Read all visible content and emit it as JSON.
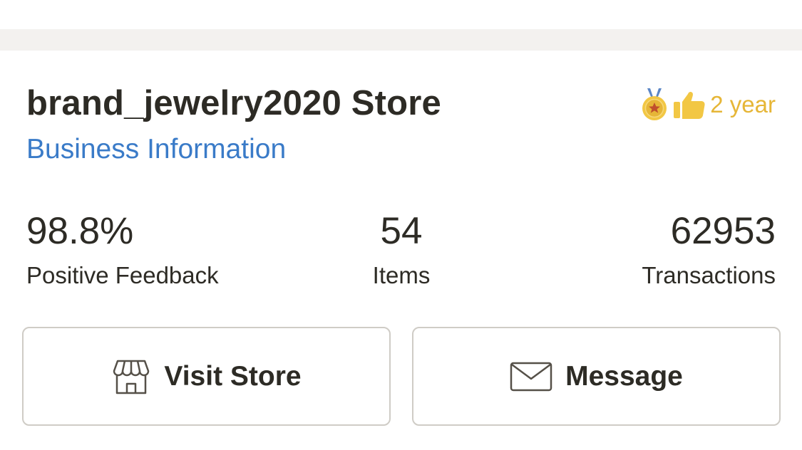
{
  "store": {
    "name": "brand_jewelry2020 Store",
    "business_link": "Business Information",
    "seller_years": "2 year",
    "badge_color": "#e6b637",
    "link_color": "#3a7bc8"
  },
  "stats": {
    "feedback": {
      "value": "98.8%",
      "label": "Positive Feedback"
    },
    "items": {
      "value": "54",
      "label": "Items"
    },
    "transactions": {
      "value": "62953",
      "label": "Transactions"
    }
  },
  "actions": {
    "visit_store": {
      "label": "Visit Store",
      "icon": "storefront-icon"
    },
    "message": {
      "label": "Message",
      "icon": "envelope-icon"
    }
  }
}
